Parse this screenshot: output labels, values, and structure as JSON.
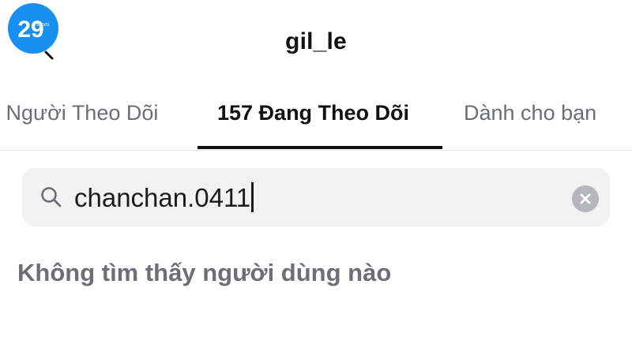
{
  "logo": {
    "text": "29",
    "subtext": "Sports",
    "color": "#1a8ff2"
  },
  "header": {
    "back_icon": "back-icon",
    "title": "gil_le"
  },
  "tabs": [
    {
      "label": "K Người Theo Dõi",
      "active": false
    },
    {
      "label": "157 Đang Theo Dõi",
      "active": true
    },
    {
      "label": "Dành cho bạn",
      "active": false
    }
  ],
  "search": {
    "icon": "search-icon",
    "value": "chanchan.0411",
    "clear_icon": "clear-icon"
  },
  "results": {
    "empty_message": "Không tìm thấy người dùng nào"
  },
  "colors": {
    "text_primary": "#111111",
    "text_secondary": "#6b6e73",
    "search_bg": "#f2f2f3",
    "clear_bg": "#b6b7bb"
  }
}
